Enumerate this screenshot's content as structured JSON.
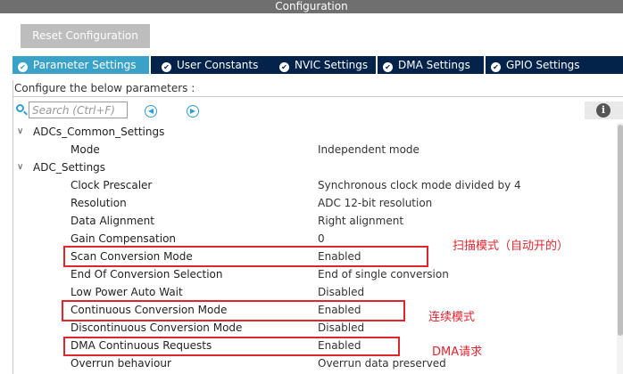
{
  "window": {
    "title": "Configuration"
  },
  "toolbar": {
    "reset_label": "Reset Configuration"
  },
  "tabs": [
    {
      "label": "Parameter Settings",
      "icon": "check-circle-icon",
      "active": true
    },
    {
      "label": "User Constants",
      "icon": "check-circle-icon",
      "active": false
    },
    {
      "label": "NVIC Settings",
      "icon": "check-circle-icon",
      "active": false
    },
    {
      "label": "DMA Settings",
      "icon": "check-circle-icon",
      "active": false
    },
    {
      "label": "GPIO Settings",
      "icon": "check-circle-icon",
      "active": false
    }
  ],
  "panel": {
    "configure_text": "Configure the below parameters :",
    "search": {
      "placeholder": "Search (Ctrl+F)",
      "value": ""
    }
  },
  "tree": {
    "common_group": {
      "label": "ADCs_Common_Settings",
      "params": [
        {
          "name": "Mode",
          "value": "Independent mode"
        }
      ]
    },
    "adc_group": {
      "label": "ADC_Settings",
      "params": [
        {
          "name": "Clock Prescaler",
          "value": "Synchronous clock mode divided by 4"
        },
        {
          "name": "Resolution",
          "value": "ADC 12-bit resolution"
        },
        {
          "name": "Data Alignment",
          "value": "Right alignment"
        },
        {
          "name": "Gain Compensation",
          "value": "0"
        },
        {
          "name": "Scan Conversion Mode",
          "value": "Enabled"
        },
        {
          "name": "End Of Conversion Selection",
          "value": "End of single conversion"
        },
        {
          "name": "Low Power Auto Wait",
          "value": "Disabled"
        },
        {
          "name": "Continuous Conversion Mode",
          "value": "Enabled"
        },
        {
          "name": "Discontinuous Conversion Mode",
          "value": "Disabled"
        },
        {
          "name": "DMA Continuous Requests",
          "value": "Enabled"
        },
        {
          "name": "Overrun behaviour",
          "value": "Overrun data preserved"
        }
      ]
    }
  },
  "annotations": {
    "scan": "扫描模式（自动开的）",
    "continuous": "连续模式",
    "dma": "DMA请求"
  },
  "colors": {
    "title_bar": "#6f6f6f",
    "tab_bar": "#03234b",
    "tab_active": "#3aa2c9",
    "annotation_red": "#e0252f"
  }
}
